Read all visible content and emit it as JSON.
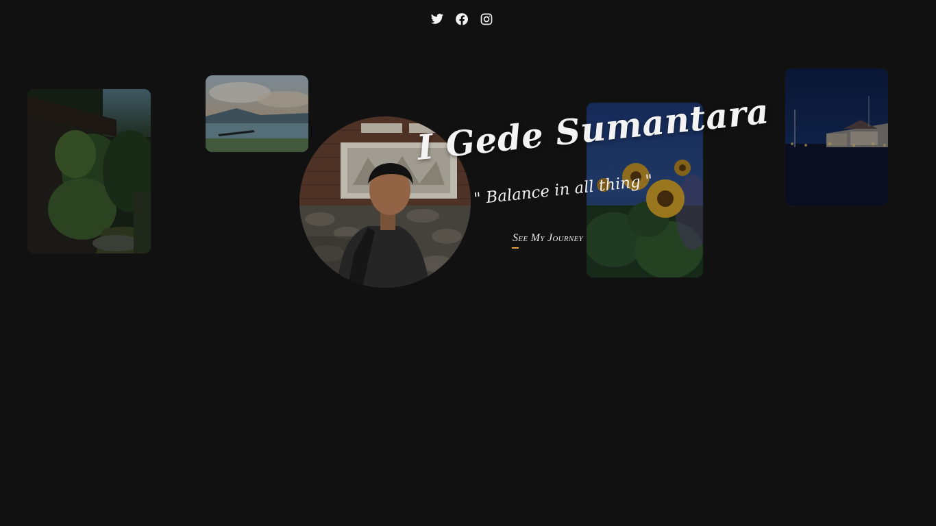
{
  "social": {
    "items": [
      {
        "icon": "twitter-icon",
        "label": "Twitter"
      },
      {
        "icon": "facebook-icon",
        "label": "Facebook"
      },
      {
        "icon": "instagram-icon",
        "label": "Instagram"
      }
    ]
  },
  "hero": {
    "name": "I Gede Sumantara",
    "quote": "\" Balance in all thing \"",
    "cta_label": "See My Journey",
    "accent_color": "#e0a04a"
  },
  "gallery": {
    "photos": [
      {
        "name": "garden-photo",
        "subject": "garden"
      },
      {
        "name": "lake-photo",
        "subject": "lake"
      },
      {
        "name": "portrait-photo",
        "subject": "portrait"
      },
      {
        "name": "sunflower-photo",
        "subject": "sunflowers"
      },
      {
        "name": "street-photo",
        "subject": "street at dusk"
      }
    ]
  },
  "theme": {
    "background": "#111112",
    "text": "#f3f3f3"
  }
}
